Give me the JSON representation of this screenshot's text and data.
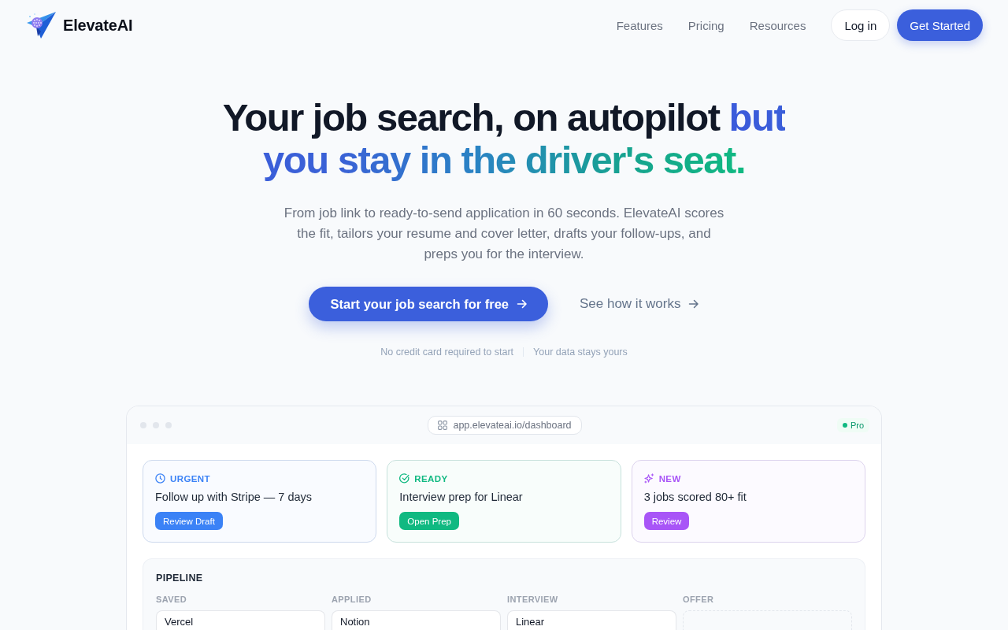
{
  "brand": {
    "name": "ElevateAI"
  },
  "nav": {
    "links": [
      "Features",
      "Pricing",
      "Resources"
    ],
    "login": "Log in",
    "cta": "Get Started"
  },
  "hero": {
    "headline": {
      "text": "Your job search, on autopilot",
      "highlight": "but you stay in the driver's seat."
    },
    "subtitle": "From job link to ready-to-send application in 60 seconds. ElevateAI scores the fit, tailors your resume and cover letter, drafts your follow-ups, and preps you for the interview.",
    "primary_cta": "Start your job search for free",
    "secondary_cta": "See how it works",
    "notes": [
      "No credit card required to start",
      "Your data stays yours"
    ]
  },
  "dashboard": {
    "url": "app.elevateai.io/dashboard",
    "plan": "Pro",
    "tasks": [
      {
        "kind": "urgent",
        "tag": "URGENT",
        "title": "Follow up with Stripe — 7 days",
        "action": "Review Draft",
        "color": "#3b82f6"
      },
      {
        "kind": "ready",
        "tag": "READY",
        "title": "Interview prep for Linear",
        "action": "Open Prep",
        "color": "#10b981"
      },
      {
        "kind": "new",
        "tag": "NEW",
        "title": "3 jobs scored 80+ fit",
        "action": "Review",
        "color": "#a855f7"
      }
    ],
    "pipeline": {
      "title": "PIPELINE",
      "columns": [
        {
          "label": "SAVED",
          "cards": [
            "Vercel"
          ]
        },
        {
          "label": "APPLIED",
          "cards": [
            "Notion"
          ]
        },
        {
          "label": "INTERVIEW",
          "cards": [
            "Linear"
          ]
        },
        {
          "label": "OFFER"
        }
      ]
    }
  }
}
